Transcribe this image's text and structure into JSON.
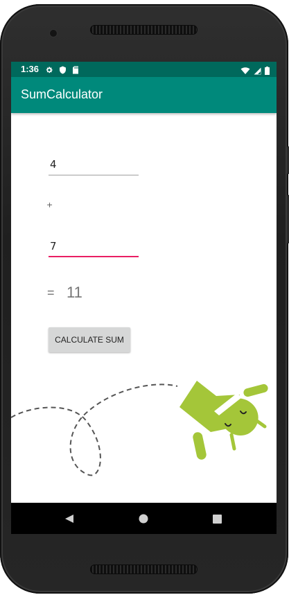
{
  "device": {
    "accent_color": "#00897b",
    "status_bar_color": "#00695c"
  },
  "status_bar": {
    "time": "1:36",
    "left_icons": [
      "gear-icon",
      "shield-icon",
      "sd-card-icon"
    ],
    "right_icons": [
      "wifi-icon",
      "cell-signal-icon",
      "battery-icon"
    ]
  },
  "app_bar": {
    "title": "SumCalculator"
  },
  "form": {
    "first_number": "4",
    "operator": "+",
    "second_number": "7",
    "equals": "=",
    "result": "11",
    "button_label": "CALCULATE SUM",
    "focus_color": "#e91e63"
  },
  "illustration": {
    "name": "android-robot-illustration",
    "robot_color": "#a4c639"
  },
  "nav_bar": {
    "buttons": [
      "back-icon",
      "home-icon",
      "recents-icon"
    ]
  }
}
